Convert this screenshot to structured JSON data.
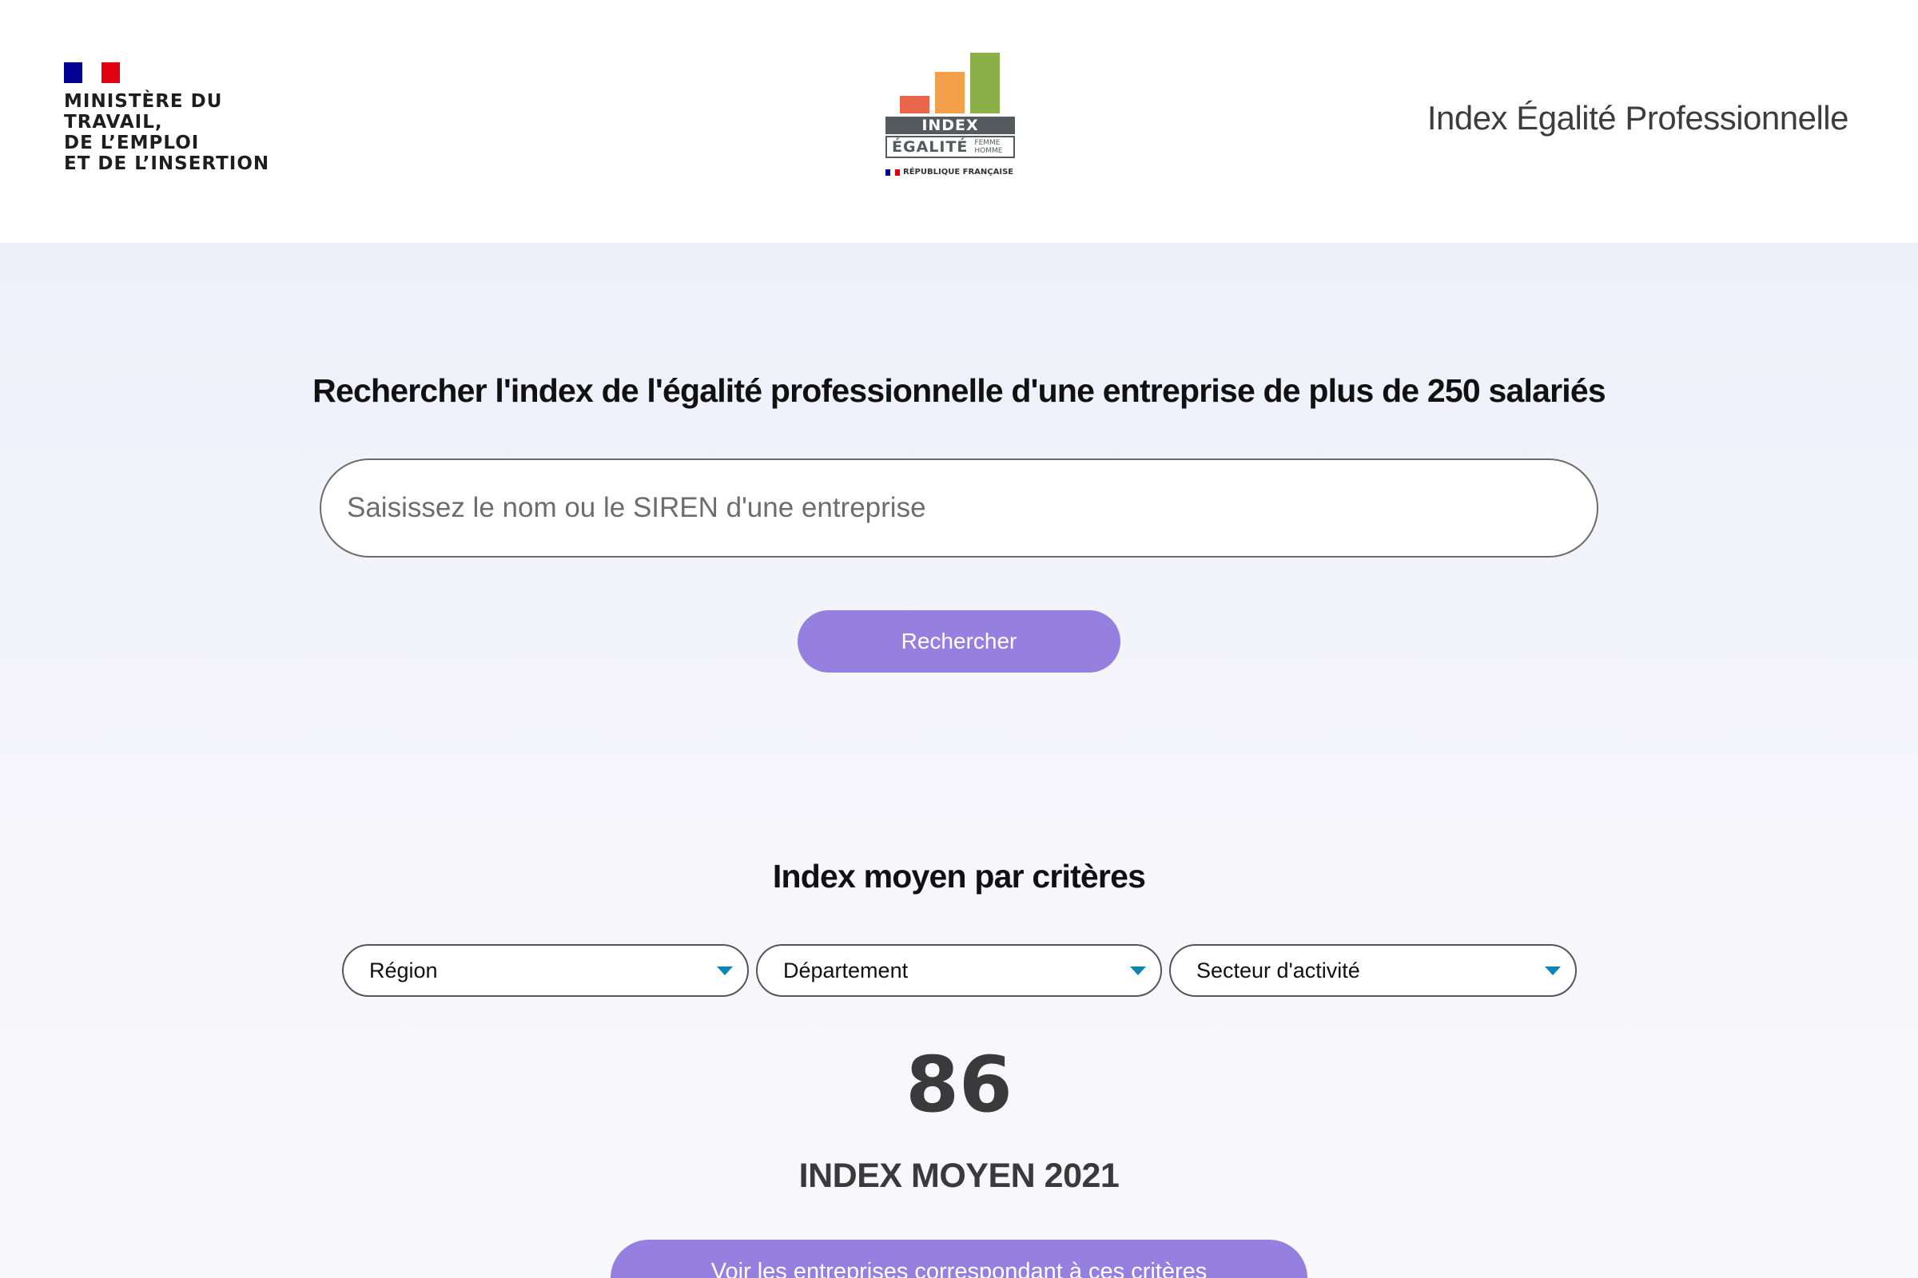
{
  "header": {
    "ministry_lines": [
      "MINISTÈRE DU",
      "TRAVAIL,",
      "DE L’EMPLOI",
      "ET DE L’INSERTION"
    ],
    "logo": {
      "index_text": "INDEX",
      "egalite_text": "ÉGALITÉ",
      "femme_text": "FEMME",
      "homme_text": "HOMME",
      "republique_text": "RÉPUBLIQUE FRANÇAISE"
    },
    "site_title": "Index Égalité Professionnelle"
  },
  "search": {
    "heading": "Rechercher l'index de l'égalité professionnelle d'une entreprise de plus de 250 salariés",
    "placeholder": "Saisissez le nom ou le SIREN d'une entreprise",
    "value": "",
    "button_label": "Rechercher"
  },
  "criteria": {
    "heading": "Index moyen par critères",
    "filters": {
      "region": "Région",
      "departement": "Département",
      "secteur": "Secteur d'activité"
    },
    "average_value": "86",
    "average_label": "INDEX MOYEN 2021",
    "companies_button_label": "Voir les entreprises correspondant à ces critères"
  },
  "colors": {
    "accent": "#9580e0",
    "page_bg": "#eeeff9",
    "caret": "#0a86b5",
    "flag_blue": "#000091",
    "flag_red": "#e1000f",
    "logo_red": "#e9664a",
    "logo_orange": "#f4a04a",
    "logo_green": "#8bb04a",
    "logo_gray": "#555a5e"
  }
}
